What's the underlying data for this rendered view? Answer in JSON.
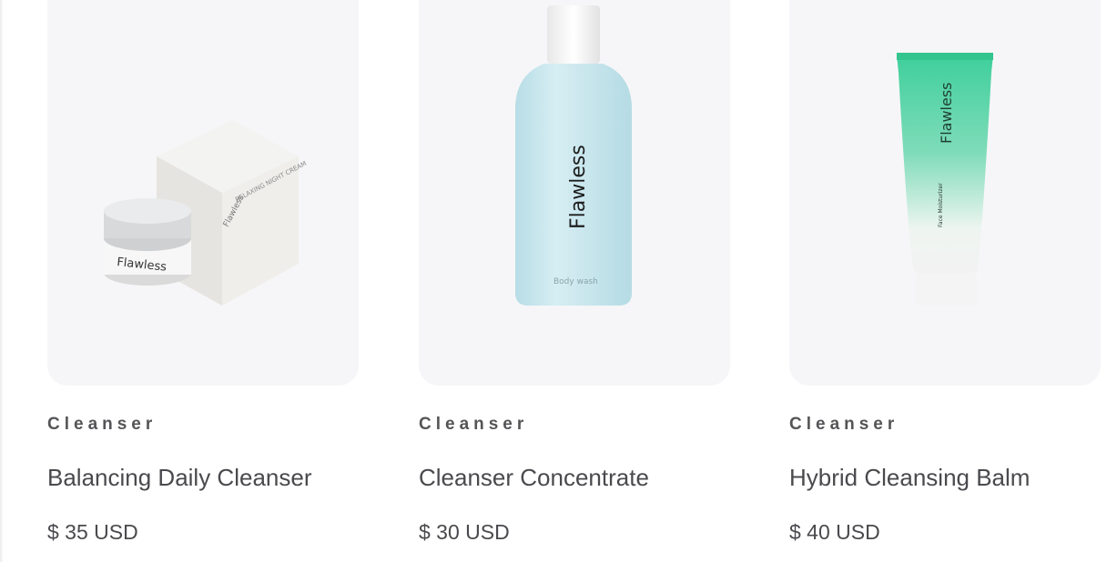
{
  "products": [
    {
      "category": "Cleanser",
      "name": "Balancing Daily Cleanser",
      "price": "$ 35 USD",
      "image": {
        "kind": "cream-jar-and-box",
        "brand": "Flawless",
        "box_text": "RELAXING NIGHT CREAM"
      }
    },
    {
      "category": "Cleanser",
      "name": "Cleanser Concentrate",
      "price": "$ 30 USD",
      "image": {
        "kind": "bottle",
        "brand": "Flawless",
        "sub": "Body wash"
      }
    },
    {
      "category": "Cleanser",
      "name": "Hybrid Cleansing Balm",
      "price": "$ 40 USD",
      "image": {
        "kind": "tube",
        "brand": "Flawless",
        "sub": "Face Moisturizer"
      }
    }
  ],
  "colors": {
    "card_bg": "#f6f6f8",
    "text": "#4a4a4e",
    "bottle": "#cde8ef",
    "tube_top": "#3fcf9c"
  }
}
